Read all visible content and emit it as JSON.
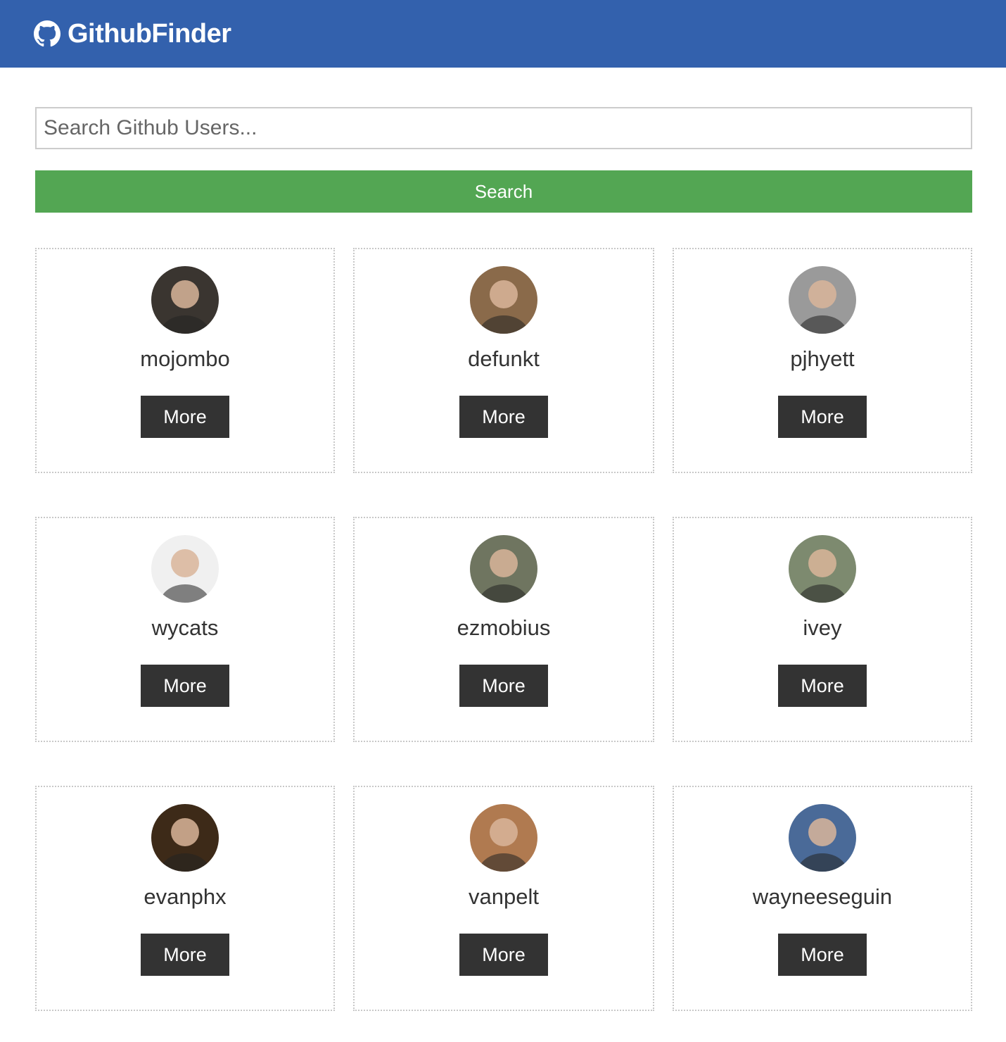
{
  "navbar": {
    "brand_icon": "github-icon",
    "title": "GithubFinder",
    "color": "#3361ad"
  },
  "search": {
    "placeholder": "Search Github Users...",
    "value": "",
    "button_label": "Search",
    "button_color": "#53a653"
  },
  "users": [
    {
      "login": "mojombo",
      "more_label": "More",
      "avatar_tone": "#3a3530"
    },
    {
      "login": "defunkt",
      "more_label": "More",
      "avatar_tone": "#8a6a4a"
    },
    {
      "login": "pjhyett",
      "more_label": "More",
      "avatar_tone": "#9a9a9a"
    },
    {
      "login": "wycats",
      "more_label": "More",
      "avatar_tone": "#f0f0f0"
    },
    {
      "login": "ezmobius",
      "more_label": "More",
      "avatar_tone": "#6f7560"
    },
    {
      "login": "ivey",
      "more_label": "More",
      "avatar_tone": "#7d8a6f"
    },
    {
      "login": "evanphx",
      "more_label": "More",
      "avatar_tone": "#3d2a18"
    },
    {
      "login": "vanpelt",
      "more_label": "More",
      "avatar_tone": "#b07a50"
    },
    {
      "login": "wayneeseguin",
      "more_label": "More",
      "avatar_tone": "#4a6a98"
    }
  ]
}
